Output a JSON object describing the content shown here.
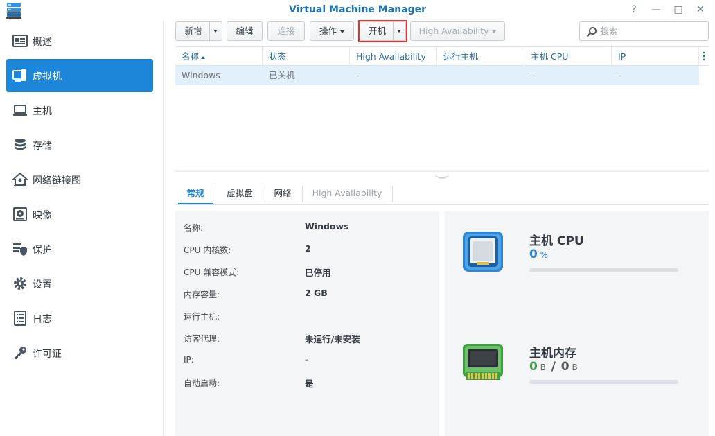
{
  "window": {
    "title": "Virtual Machine Manager",
    "help_glyph": "?",
    "minimize_glyph": "—",
    "maximize_glyph": "□",
    "close_glyph": "✕"
  },
  "sidebar": {
    "items": [
      {
        "label": "概述",
        "icon": "overview-icon",
        "active": false
      },
      {
        "label": "虚拟机",
        "icon": "virtual-machine-icon",
        "active": true
      },
      {
        "label": "主机",
        "icon": "host-laptop-icon",
        "active": false
      },
      {
        "label": "存储",
        "icon": "storage-database-icon",
        "active": false
      },
      {
        "label": "网络链接图",
        "icon": "network-house-icon",
        "active": false
      },
      {
        "label": "映像",
        "icon": "disc-image-icon",
        "active": false
      },
      {
        "label": "保护",
        "icon": "protection-shield-icon",
        "active": false
      },
      {
        "label": "设置",
        "icon": "gear-icon",
        "active": false
      },
      {
        "label": "日志",
        "icon": "log-list-icon",
        "active": false
      },
      {
        "label": "许可证",
        "icon": "license-key-icon",
        "active": false
      }
    ]
  },
  "toolbar": {
    "create": "新增",
    "edit": "编辑",
    "connect": "连接",
    "action": "操作",
    "power_on": "开机",
    "high_availability": "High Availability"
  },
  "search": {
    "placeholder": "搜索"
  },
  "grid": {
    "columns": [
      "名称",
      "状态",
      "High Availability",
      "运行主机",
      "主机 CPU",
      "IP"
    ],
    "rows": [
      {
        "name": "Windows",
        "status": "已关机",
        "ha": "-",
        "host": "",
        "cpu": "-",
        "ip": "-"
      }
    ]
  },
  "tabs": [
    "常规",
    "虚拟盘",
    "网络",
    "High Availability"
  ],
  "details": [
    {
      "label": "名称:",
      "value": "Windows"
    },
    {
      "label": "CPU 内核数:",
      "value": "2"
    },
    {
      "label": "CPU 兼容模式:",
      "value": "已停用"
    },
    {
      "label": "内存容量:",
      "value": "2 GB"
    },
    {
      "label": "运行主机:",
      "value": ""
    },
    {
      "label": "访客代理:",
      "value": "未运行/未安装"
    },
    {
      "label": "IP:",
      "value": "-"
    },
    {
      "label": "自动启动:",
      "value": "是"
    }
  ],
  "resources": {
    "cpu": {
      "title": "主机 CPU",
      "value": "0",
      "unit": "%",
      "usage_fraction": 0.0
    },
    "memory": {
      "title": "主机内存",
      "used": "0",
      "used_unit": "B",
      "separator": "/",
      "total": "0",
      "total_unit": "B",
      "usage_fraction": 0.0
    }
  }
}
